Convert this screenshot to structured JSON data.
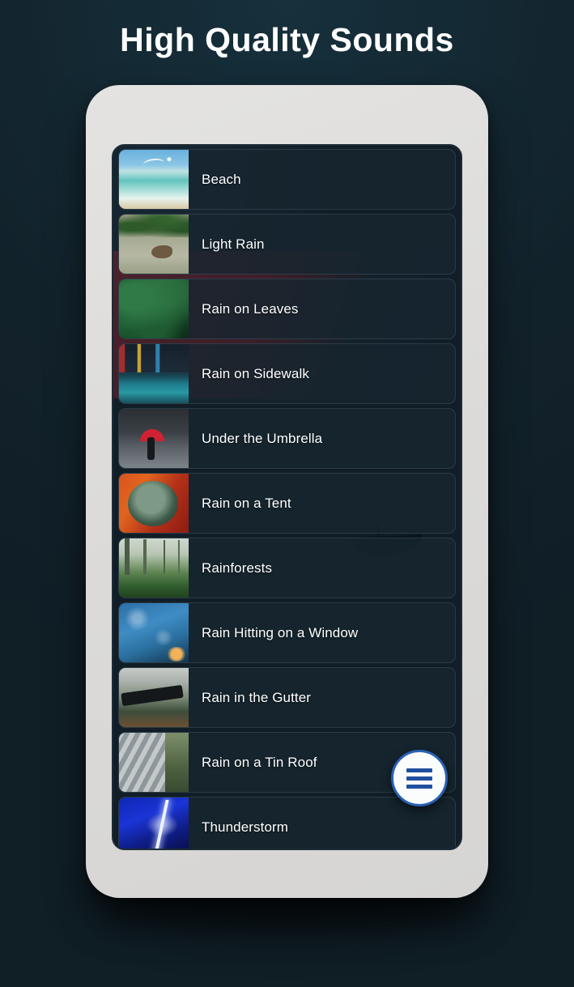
{
  "page": {
    "headline": "High Quality Sounds",
    "background_color": "#12222b",
    "phone_frame_color": "#dddcda",
    "screen_background": "#121e27"
  },
  "accent": {
    "fab_border": "#2961b5",
    "fab_icon": "#1f4f9e",
    "fab_background": "#fbfcfc",
    "row_text": "#ffffff"
  },
  "sound_list": {
    "items": [
      {
        "label": "Beach",
        "icon": "beach-thumbnail",
        "art": "t-beach"
      },
      {
        "label": "Light Rain",
        "icon": "light-rain-thumbnail",
        "art": "t-lightrain"
      },
      {
        "label": "Rain on Leaves",
        "icon": "rain-on-leaves-thumbnail",
        "art": "t-leaves"
      },
      {
        "label": "Rain on Sidewalk",
        "icon": "rain-on-sidewalk-thumbnail",
        "art": "t-sidewalk"
      },
      {
        "label": "Under the Umbrella",
        "icon": "under-the-umbrella-thumbnail",
        "art": "t-umbrella"
      },
      {
        "label": "Rain on a Tent",
        "icon": "rain-on-a-tent-thumbnail",
        "art": "t-tent"
      },
      {
        "label": "Rainforests",
        "icon": "rainforests-thumbnail",
        "art": "t-rainforest"
      },
      {
        "label": "Rain Hitting on a Window",
        "icon": "rain-on-window-thumbnail",
        "art": "t-window"
      },
      {
        "label": "Rain in the Gutter",
        "icon": "rain-in-the-gutter-thumbnail",
        "art": "t-gutter"
      },
      {
        "label": "Rain on a Tin Roof",
        "icon": "rain-on-a-tin-roof-thumbnail",
        "art": "t-tinroof"
      },
      {
        "label": "Thunderstorm",
        "icon": "thunderstorm-thumbnail",
        "art": "t-thunder"
      }
    ]
  },
  "fab": {
    "icon": "hamburger-menu-icon",
    "label": "Menu"
  }
}
